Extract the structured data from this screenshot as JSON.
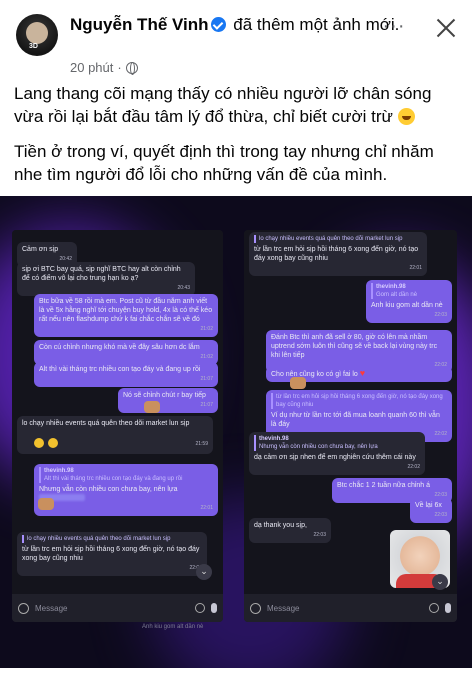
{
  "post": {
    "author": "Nguyễn Thế Vinh",
    "action": "đã thêm một ảnh mới.",
    "time": "20 phút",
    "more_label": "···",
    "avatar_text": "3D",
    "paragraph1": "Lang thang cõi mạng thấy có nhiều người lỡ chân sóng vừa rồi lại bắt đầu tâm lý đổ thừa, chỉ biết cười trừ",
    "paragraph2": "Tiền ở trong ví, quyết định thì trong tay nhưng chỉ nhăm nhe tìm người đổ lỗi cho những vấn đề của mình."
  },
  "left_chat": {
    "messages": [
      {
        "text": "Cảm ơn sịp",
        "ts": "20:42"
      },
      {
        "text": "sịp ơi BTC bay quá, sịp nghĩ BTC hay alt còn chỉnh để có điểm vô lại cho trung hạn ko ạ?",
        "ts": "20:43"
      },
      {
        "text": "Btc bữa về 58 rồi mà em. Post cũ từ đầu năm anh viết là về 5x hằng nghĩ tới chuyện buy hold, 4x là có thể kéo rất nếu nên flashdump chứ k fai chắc chắn sẽ về đó",
        "ts": "21:02"
      },
      {
        "text": "Còn cú chỉnh nhưng khó mà về đây sâu hơn dc lắm",
        "ts": "21:02"
      },
      {
        "text": "Alt thì vài tháng trc nhiều con tạo đáy và đang up rồi",
        "ts": "21:07"
      },
      {
        "text": "Nó sẽ chỉnh chút r bay tiếp",
        "ts": "21:07"
      },
      {
        "text": "lo chạy nhiều events quá quên theo dõi market lun sịp",
        "ts": "21:59"
      },
      {
        "text": "Alt thì vài tháng trc nhiều con tạo đáy và đang up rồi",
        "ts": ""
      },
      {
        "text": "Nhưng vẫn còn nhiều con chưa bay, nên lựa",
        "ts": "22:01"
      },
      {
        "text": "lo chạy nhiều events quá quên theo dõi market lun sịp",
        "ts": ""
      },
      {
        "text": "từ lần trc em hỏi sịp hồi tháng 6 xong đến giờ, nó tạo đáy xong bay cũng nhiu",
        "ts": "22:01"
      }
    ],
    "reply_name": "thevinh.98",
    "composer_placeholder": "Message",
    "footer_hint": "Anh kiu gom alt dần nè"
  },
  "right_chat": {
    "messages": [
      {
        "text": "lo chạy nhiều events quá quên theo dõi market lun sịp",
        "ts": ""
      },
      {
        "text": "từ lần trc em hỏi sịp hồi tháng 6 xong đến giờ, nó tạo đáy xong bay cũng nhiu",
        "ts": "22:01"
      },
      {
        "text": "Gom alt dần nè",
        "ts": ""
      },
      {
        "text": "Anh kiu gom alt dần nè",
        "ts": "22:03"
      },
      {
        "text": "Đánh Btc thì anh đã sell ở 80, giờ có lên mà nhầm uptrend sớm luôn thì cũng sẽ về back lại vùng này trc khi lên tiếp",
        "ts": "22:02"
      },
      {
        "text": "Cho nên cũng ko có gì fai lo",
        "ts": ""
      },
      {
        "text": "từ lần trc em hỏi sịp hồi tháng 6 xong đến giờ, nó tạo đáy xong bay cũng nhiu",
        "ts": ""
      },
      {
        "text": "Ví dụ như từ lần trc tới đã mua loanh quanh 60 thì vẫn là đáy",
        "ts": "22:02"
      },
      {
        "text": "Nhưng vẫn còn nhiều con chưa bay, nên lựa",
        "ts": ""
      },
      {
        "text": "dạ cảm ơn sịp nhen",
        "ts": ""
      },
      {
        "text": "để em nghiên cứu thêm cái này",
        "ts": "22:02"
      },
      {
        "text": "Btc chắc 1 2 tuần nữa chỉnh á",
        "ts": "22:03"
      },
      {
        "text": "Về lại 6x",
        "ts": "22:03"
      },
      {
        "text": "dạ thank you sịp,",
        "ts": "22:03"
      }
    ],
    "reply_name": "thevinh.98",
    "composer_placeholder": "Message"
  },
  "colors": {
    "accent": "#1877f2",
    "bubble_out": "#7a5ee6",
    "bubble_in": "#272733",
    "photo_bg": "#0d0a1c"
  }
}
